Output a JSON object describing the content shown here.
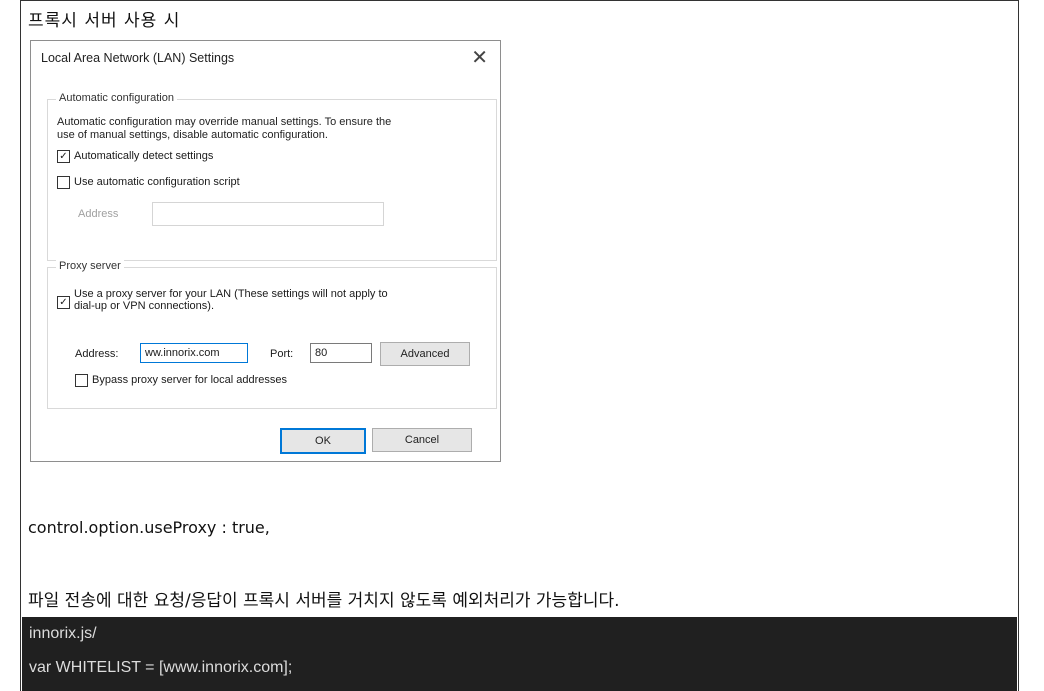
{
  "section_title": "프록시 서버 사용 시",
  "dialog": {
    "title": "Local Area Network (LAN) Settings",
    "close_glyph": "✕",
    "auto_config": {
      "legend": "Automatic configuration",
      "description_line1": "Automatic configuration may override manual settings.  To ensure the",
      "description_line2": "use of manual settings, disable automatic configuration.",
      "auto_detect_label": "Automatically detect settings",
      "auto_detect_checked": true,
      "use_script_label": "Use automatic configuration script",
      "use_script_checked": false,
      "address_label": "Address"
    },
    "proxy": {
      "legend": "Proxy server",
      "use_proxy_line1": "Use a proxy server for your LAN (These settings will not apply to",
      "use_proxy_line2": "dial-up or VPN connections).",
      "use_proxy_checked": true,
      "address_label": "Address:",
      "address_value": "ww.innorix.com",
      "port_label": "Port:",
      "port_value": "80",
      "advanced_label": "Advanced",
      "bypass_label": "Bypass proxy server for local addresses",
      "bypass_checked": false
    },
    "ok_label": "OK",
    "cancel_label": "Cancel",
    "check_glyph": "✓"
  },
  "option_text": "control.option.useProxy : true,",
  "exception_text": "파일 전송에 대한 요청/응답이 프록시 서버를 거치지 않도록 예외처리가 가능합니다.",
  "code": {
    "line1": "innorix.js/",
    "line2": "var WHITELIST = [www.innorix.com];"
  }
}
